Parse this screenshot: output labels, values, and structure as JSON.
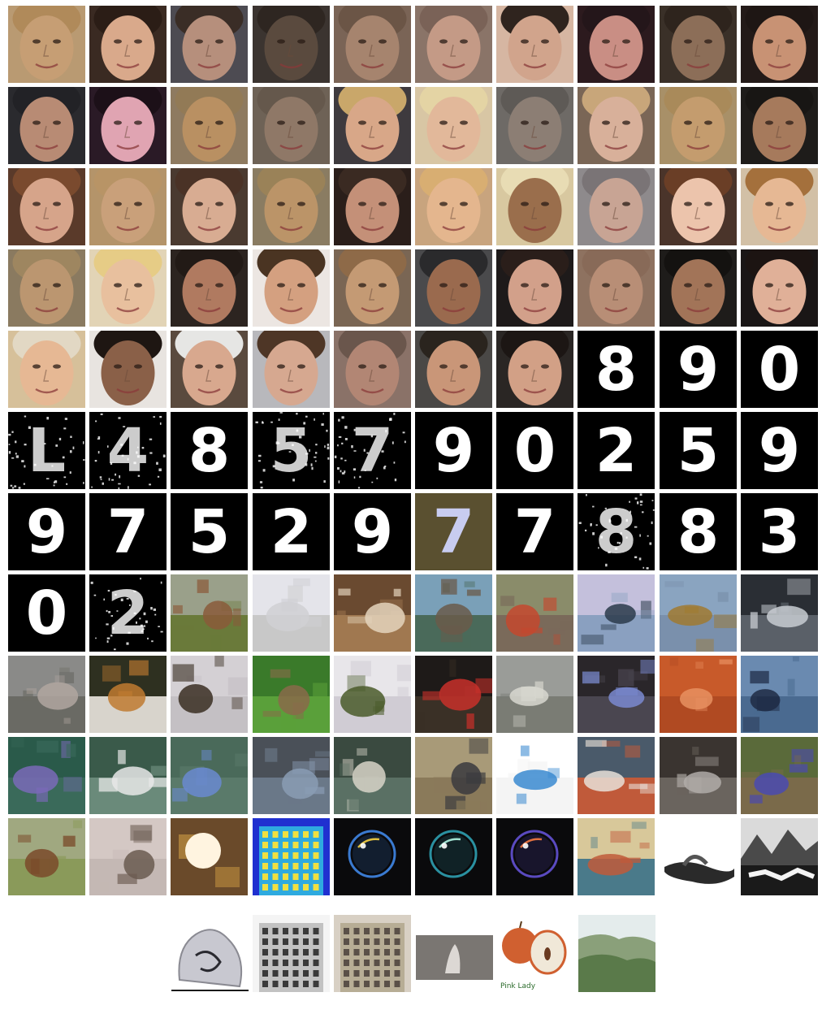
{
  "colors": {
    "background": "#ffffff",
    "digit_bg": "#000000",
    "digit_fg": "#ffffff"
  },
  "rows": [
    {
      "kind": "face",
      "tiles": [
        {
          "icon": "face-icon",
          "bg": "#b99a72",
          "skin": "#c69e74",
          "hair": "#b08a5a"
        },
        {
          "icon": "face-icon",
          "bg": "#3a2a22",
          "skin": "#d9a98b",
          "hair": "#2b1d16"
        },
        {
          "icon": "face-icon",
          "bg": "#4d4b52",
          "skin": "#b68f7c",
          "hair": "#3a2d26"
        },
        {
          "icon": "face-icon",
          "bg": "#3b3430",
          "skin": "#5a4a3e",
          "hair": "#2e2621"
        },
        {
          "icon": "face-icon",
          "bg": "#7a6456",
          "skin": "#a6846e",
          "hair": "#6b5546"
        },
        {
          "icon": "face-icon",
          "bg": "#8a7468",
          "skin": "#c49a86",
          "hair": "#7a6257"
        },
        {
          "icon": "face-icon",
          "bg": "#d6b6a2",
          "skin": "#d1a48c",
          "hair": "#2f241e"
        },
        {
          "icon": "face-icon",
          "bg": "#2c1a1e",
          "skin": "#c98e84",
          "hair": "#24161a"
        },
        {
          "icon": "face-icon",
          "bg": "#3a3028",
          "skin": "#8c6e58",
          "hair": "#2e241d"
        },
        {
          "icon": "face-icon",
          "bg": "#231a18",
          "skin": "#c89274",
          "hair": "#1e1614"
        }
      ]
    },
    {
      "kind": "face",
      "tiles": [
        {
          "icon": "face-icon",
          "bg": "#2a2a2e",
          "skin": "#b88b74",
          "hair": "#222226"
        },
        {
          "icon": "face-icon",
          "bg": "#2a1a26",
          "skin": "#e0a4b2",
          "hair": "#1c1018"
        },
        {
          "icon": "face-icon",
          "bg": "#8e7a60",
          "skin": "#b99062",
          "hair": "#927a56"
        },
        {
          "icon": "face-icon",
          "bg": "#6e6256",
          "skin": "#8f7867",
          "hair": "#65584c"
        },
        {
          "icon": "face-icon",
          "bg": "#3e3a3e",
          "skin": "#d8a788",
          "hair": "#c9a76a"
        },
        {
          "icon": "face-icon",
          "bg": "#d8c6a4",
          "skin": "#e2b89a",
          "hair": "#e4d4a4"
        },
        {
          "icon": "face-icon",
          "bg": "#6e6a66",
          "skin": "#8c7e74",
          "hair": "#5e5a56"
        },
        {
          "icon": "face-icon",
          "bg": "#7a6656",
          "skin": "#d8b09a",
          "hair": "#c8a67a"
        },
        {
          "icon": "face-icon",
          "bg": "#a89068",
          "skin": "#c49c6e",
          "hair": "#a98a5a"
        },
        {
          "icon": "face-icon",
          "bg": "#1e1c1a",
          "skin": "#a67a5c",
          "hair": "#181614"
        }
      ]
    },
    {
      "kind": "face",
      "tiles": [
        {
          "icon": "face-icon",
          "bg": "#5a3a2a",
          "skin": "#d6a48a",
          "hair": "#7a4a2e"
        },
        {
          "icon": "face-icon",
          "bg": "#b4946a",
          "skin": "#c9a07a",
          "hair": "#b89466"
        },
        {
          "icon": "face-icon",
          "bg": "#4a3a30",
          "skin": "#d8ac92",
          "hair": "#4a3226"
        },
        {
          "icon": "face-icon",
          "bg": "#8a7c62",
          "skin": "#bb9468",
          "hair": "#9a8258"
        },
        {
          "icon": "face-icon",
          "bg": "#2a1e1a",
          "skin": "#c49078",
          "hair": "#3a2a22"
        },
        {
          "icon": "face-icon",
          "bg": "#c8a47e",
          "skin": "#e4b68e",
          "hair": "#d8ae72"
        },
        {
          "icon": "face-icon",
          "bg": "#d8c8a0",
          "skin": "#9a6e4c",
          "hair": "#e8dcb4"
        },
        {
          "icon": "face-icon",
          "bg": "#8e8a8c",
          "skin": "#c8a494",
          "hair": "#7a7476"
        },
        {
          "icon": "face-icon",
          "bg": "#4a342a",
          "skin": "#ecc4ac",
          "hair": "#6a3e26"
        },
        {
          "icon": "face-icon",
          "bg": "#d2c0a6",
          "skin": "#e6b894",
          "hair": "#a4703c"
        }
      ]
    },
    {
      "kind": "face",
      "tiles": [
        {
          "icon": "face-icon",
          "bg": "#8a7a60",
          "skin": "#bb9670",
          "hair": "#9e8660"
        },
        {
          "icon": "face-icon",
          "bg": "#e2d4b6",
          "skin": "#e8c09e",
          "hair": "#e6cc86"
        },
        {
          "icon": "face-icon",
          "bg": "#2c2420",
          "skin": "#b07a60",
          "hair": "#221a16"
        },
        {
          "icon": "face-icon",
          "bg": "#ece6e2",
          "skin": "#d4a080",
          "hair": "#4a3422"
        },
        {
          "icon": "face-icon",
          "bg": "#7a6654",
          "skin": "#c49a74",
          "hair": "#8e6a48"
        },
        {
          "icon": "face-icon",
          "bg": "#4a4a4c",
          "skin": "#9a6a4e",
          "hair": "#2a2a2c"
        },
        {
          "icon": "face-icon",
          "bg": "#1e1a1a",
          "skin": "#d2a08a",
          "hair": "#2a1e1a"
        },
        {
          "icon": "face-icon",
          "bg": "#8e7260",
          "skin": "#b88e76",
          "hair": "#886a58"
        },
        {
          "icon": "face-icon",
          "bg": "#1e1c1a",
          "skin": "#a27458",
          "hair": "#141210"
        },
        {
          "icon": "face-icon",
          "bg": "#1a1616",
          "skin": "#e0b098",
          "hair": "#1c1412"
        }
      ]
    },
    {
      "kind": "mixed",
      "tiles": [
        {
          "icon": "face-icon",
          "bg": "#d6c09a",
          "skin": "#e6b894",
          "hair": "#e2d8c4"
        },
        {
          "icon": "face-icon",
          "bg": "#e8e4e0",
          "skin": "#8a6048",
          "hair": "#1e1612"
        },
        {
          "icon": "face-icon",
          "bg": "#5a4a3e",
          "skin": "#d8a88e",
          "hair": "#e6e6e4"
        },
        {
          "icon": "face-icon",
          "bg": "#b8b8bc",
          "skin": "#d6a890",
          "hair": "#4e3626"
        },
        {
          "icon": "face-icon",
          "bg": "#8a7268",
          "skin": "#b28674",
          "hair": "#6a564c"
        },
        {
          "icon": "face-icon",
          "bg": "#4a4846",
          "skin": "#c99678",
          "hair": "#2a241e"
        },
        {
          "icon": "face-icon",
          "bg": "#2a2624",
          "skin": "#d2a086",
          "hair": "#1c1614"
        },
        {
          "icon": "digit-icon",
          "digit": "8"
        },
        {
          "icon": "digit-icon",
          "digit": "9"
        },
        {
          "icon": "digit-icon",
          "digit": "0"
        }
      ]
    },
    {
      "kind": "digit",
      "tiles": [
        {
          "icon": "digit-icon",
          "digit": "L",
          "noisy": true
        },
        {
          "icon": "digit-icon",
          "digit": "4",
          "noisy": true
        },
        {
          "icon": "digit-icon",
          "digit": "8"
        },
        {
          "icon": "digit-icon",
          "digit": "5",
          "noisy": true
        },
        {
          "icon": "digit-icon",
          "digit": "7",
          "noisy": true
        },
        {
          "icon": "digit-icon",
          "digit": "9"
        },
        {
          "icon": "digit-icon",
          "digit": "0"
        },
        {
          "icon": "digit-icon",
          "digit": "2"
        },
        {
          "icon": "digit-icon",
          "digit": "5"
        },
        {
          "icon": "digit-icon",
          "digit": "9"
        }
      ]
    },
    {
      "kind": "digit",
      "tiles": [
        {
          "icon": "digit-icon",
          "digit": "9"
        },
        {
          "icon": "digit-icon",
          "digit": "7"
        },
        {
          "icon": "digit-icon",
          "digit": "5"
        },
        {
          "icon": "digit-icon",
          "digit": "2"
        },
        {
          "icon": "digit-icon",
          "digit": "9"
        },
        {
          "icon": "digit-icon",
          "digit": "7",
          "bg": "#5a5030",
          "fg": "#c8ccf0"
        },
        {
          "icon": "digit-icon",
          "digit": "7"
        },
        {
          "icon": "digit-icon",
          "digit": "8",
          "noisy": true
        },
        {
          "icon": "digit-icon",
          "digit": "8"
        },
        {
          "icon": "digit-icon",
          "digit": "3"
        }
      ]
    },
    {
      "kind": "mixed",
      "tiles": [
        {
          "icon": "digit-icon",
          "digit": "0"
        },
        {
          "icon": "digit-icon",
          "digit": "2",
          "noisy": true
        },
        {
          "icon": "scene-icon",
          "sky": "#9aa08a",
          "ground": "#6a7a3a",
          "obj": "#8a5a3a"
        },
        {
          "icon": "scene-icon",
          "sky": "#e4e4ea",
          "ground": "#c8c8c8",
          "obj": "#d0d0d4"
        },
        {
          "icon": "scene-icon",
          "sky": "#6a4a30",
          "ground": "#a07850",
          "obj": "#e4d4bc"
        },
        {
          "icon": "scene-icon",
          "sky": "#7aa0b8",
          "ground": "#4a6a5a",
          "obj": "#6a5a4a"
        },
        {
          "icon": "scene-icon",
          "sky": "#8a8c6a",
          "ground": "#7a6a5a",
          "obj": "#c4482e"
        },
        {
          "icon": "scene-icon",
          "sky": "#c4c0dc",
          "ground": "#8aa0c0",
          "obj": "#2a3a4a"
        },
        {
          "icon": "scene-icon",
          "sky": "#8aa4c0",
          "ground": "#7a90ac",
          "obj": "#a07a30"
        },
        {
          "icon": "scene-icon",
          "sky": "#2a2e34",
          "ground": "#5a6068",
          "obj": "#c8ccd2"
        }
      ]
    },
    {
      "kind": "scene",
      "tiles": [
        {
          "icon": "scene-icon",
          "sky": "#8a8a88",
          "ground": "#6a6a64",
          "obj": "#b0a6a0"
        },
        {
          "icon": "scene-icon",
          "sky": "#2e3020",
          "ground": "#d8d4cc",
          "obj": "#c07a30"
        },
        {
          "icon": "scene-icon",
          "sky": "#d4d0d4",
          "ground": "#c4c0c4",
          "obj": "#3a2e22"
        },
        {
          "icon": "scene-icon",
          "sky": "#3a7a2a",
          "ground": "#5aa03a",
          "obj": "#8a6a4a"
        },
        {
          "icon": "scene-icon",
          "sky": "#e8e6ea",
          "ground": "#d0ccd4",
          "obj": "#4a5a2a"
        },
        {
          "icon": "scene-icon",
          "sky": "#1e1a18",
          "ground": "#3a3026",
          "obj": "#c8302a"
        },
        {
          "icon": "scene-icon",
          "sky": "#9a9c98",
          "ground": "#7a7c74",
          "obj": "#d8d8d0"
        },
        {
          "icon": "scene-icon",
          "sky": "#2a262a",
          "ground": "#4a4650",
          "obj": "#7a8ad0"
        },
        {
          "icon": "scene-icon",
          "sky": "#c85a2a",
          "ground": "#b04a22",
          "obj": "#e89060"
        },
        {
          "icon": "scene-icon",
          "sky": "#6a8ab0",
          "ground": "#4a6a90",
          "obj": "#1e2a44"
        }
      ]
    },
    {
      "kind": "scene",
      "tiles": [
        {
          "icon": "scene-icon",
          "sky": "#2a5a4a",
          "ground": "#3a6a5a",
          "obj": "#7a6ab8"
        },
        {
          "icon": "scene-icon",
          "sky": "#3a5a4a",
          "ground": "#6a8a7a",
          "obj": "#e8e8e8"
        },
        {
          "icon": "scene-icon",
          "sky": "#4a6a5a",
          "ground": "#5a7a6a",
          "obj": "#6a8ad0"
        },
        {
          "icon": "scene-icon",
          "sky": "#4a5058",
          "ground": "#6a7888",
          "obj": "#8a9cb4"
        },
        {
          "icon": "scene-icon",
          "sky": "#3a4a40",
          "ground": "#5a7064",
          "obj": "#d8d4c8"
        },
        {
          "icon": "scene-icon",
          "sky": "#a89a78",
          "ground": "#8a7a5a",
          "obj": "#3a3a3e"
        },
        {
          "icon": "scene-icon",
          "sky": "#ffffff",
          "ground": "#f4f4f4",
          "obj": "#3a8ad0"
        },
        {
          "icon": "scene-icon",
          "sky": "#4a5a6a",
          "ground": "#c05a3a",
          "obj": "#e8e0d8"
        },
        {
          "icon": "scene-icon",
          "sky": "#3a3430",
          "ground": "#6a645e",
          "obj": "#b0aca8"
        },
        {
          "icon": "scene-icon",
          "sky": "#5a6a3a",
          "ground": "#7a6a4a",
          "obj": "#4a4ab0"
        }
      ]
    },
    {
      "kind": "texture",
      "tiles": [
        {
          "icon": "scene-icon",
          "sky": "#a0a880",
          "ground": "#8a9a5a",
          "obj": "#7a4a2a"
        },
        {
          "icon": "scene-icon",
          "sky": "#d4c8c4",
          "ground": "#c4b8b4",
          "obj": "#6a5a50"
        },
        {
          "icon": "glow-icon",
          "sky": "#6a4a2a",
          "ground": "#fff4e0",
          "obj": "#c09040"
        },
        {
          "icon": "building-icon",
          "sky": "#2030d0",
          "ground": "#f0e040",
          "obj": "#30b8e0"
        },
        {
          "icon": "bubble-icon",
          "sky": "#0a0a0c",
          "ground": "#3a7ad0",
          "obj": "#e0c040"
        },
        {
          "icon": "bubble-icon",
          "sky": "#0a0a0c",
          "ground": "#2a90a0",
          "obj": "#a0e0d0"
        },
        {
          "icon": "bubble-icon",
          "sky": "#0a0a0c",
          "ground": "#5a4ac0",
          "obj": "#e07040"
        },
        {
          "icon": "scene-icon",
          "sky": "#d8c89a",
          "ground": "#4a7a8a",
          "obj": "#c05a3a"
        },
        {
          "icon": "sandal-icon",
          "sky": "#ffffff",
          "ground": "#ffffff",
          "obj": "#2a2a2a"
        },
        {
          "icon": "mountain-icon",
          "sky": "#dadada",
          "ground": "#1a1a1a",
          "obj": "#f4f4f4"
        }
      ]
    }
  ],
  "bottom_row": [
    {
      "icon": "sketch-icon",
      "sky": "#ffffff",
      "ground": "#ffffff",
      "obj": "#8a8a92"
    },
    {
      "icon": "building-icon",
      "sky": "#f4f4f4",
      "ground": "#3a3a3a",
      "obj": "#bcbcbc"
    },
    {
      "icon": "building-icon",
      "sky": "#d8d0c4",
      "ground": "#5a5048",
      "obj": "#b4a890"
    },
    {
      "icon": "rock-icon",
      "sky": "#ffffff",
      "ground": "#7a7672",
      "obj": "#dcd8d4"
    },
    {
      "icon": "apple-icon",
      "sky": "#ffffff",
      "ground": "#f0e8d8",
      "obj": "#d06030",
      "caption": "Pink Lady"
    },
    {
      "icon": "landscape-icon",
      "sky": "#e4ecec",
      "ground": "#5a7a4a",
      "obj": "#8aa07a"
    }
  ]
}
